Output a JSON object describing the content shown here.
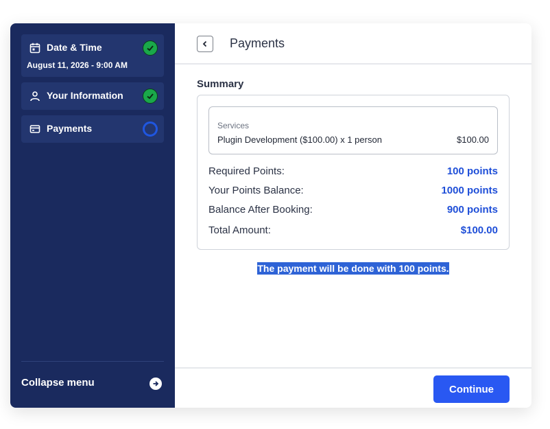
{
  "sidebar": {
    "steps": [
      {
        "title": "Date & Time",
        "subtitle": "August 11, 2026 - 9:00 AM",
        "icon": "calendar-icon",
        "status": "completed"
      },
      {
        "title": "Your Information",
        "icon": "user-icon",
        "status": "completed"
      },
      {
        "title": "Payments",
        "icon": "credit-card-icon",
        "status": "current"
      }
    ],
    "collapse_label": "Collapse menu"
  },
  "header": {
    "title": "Payments"
  },
  "summary": {
    "label": "Summary",
    "services_title": "Services",
    "service_name": "Plugin Development ($100.00) x 1 person",
    "service_price": "$100.00",
    "rows": [
      {
        "label": "Required Points:",
        "value": "100 points"
      },
      {
        "label": "Your Points Balance:",
        "value": "1000 points"
      },
      {
        "label": "Balance After Booking:",
        "value": "900 points"
      },
      {
        "label": "Total Amount:",
        "value": "$100.00"
      }
    ]
  },
  "note": "The payment will be done with 100 points.",
  "footer": {
    "continue_label": "Continue"
  },
  "colors": {
    "sidebar_bg": "#1a2a5e",
    "step_bg": "#23366f",
    "accent": "#2958f2",
    "value_text": "#1f4fd8",
    "done": "#1aa84a"
  }
}
